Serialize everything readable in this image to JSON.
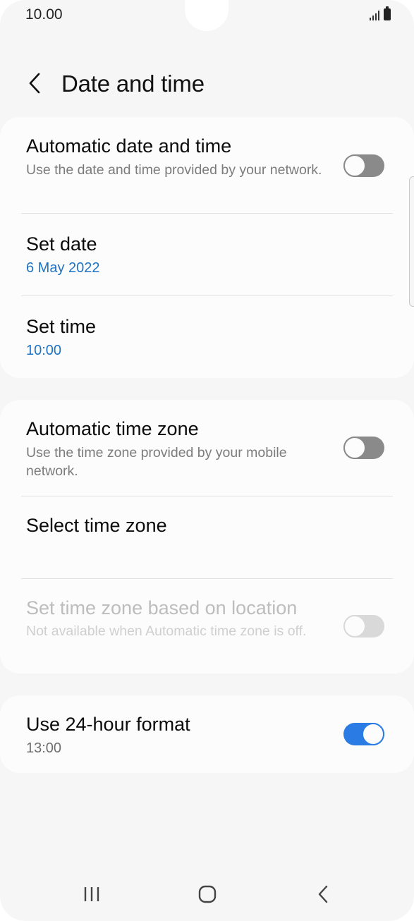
{
  "status_bar": {
    "time": "10.00",
    "signal_icon": "signal-bars-icon",
    "battery_icon": "battery-icon"
  },
  "header": {
    "back_icon": "chevron-left-icon",
    "title": "Date and time"
  },
  "section1": {
    "auto_date_time": {
      "title": "Automatic date and time",
      "subtitle": "Use the date and time provided by your network.",
      "enabled": false
    },
    "set_date": {
      "title": "Set date",
      "value": "6 May 2022"
    },
    "set_time": {
      "title": "Set time",
      "value": "10:00"
    }
  },
  "section2": {
    "auto_time_zone": {
      "title": "Automatic time zone",
      "subtitle": "Use the time zone provided by your mobile network.",
      "enabled": false
    },
    "select_time_zone": {
      "title": "Select time zone"
    },
    "time_zone_location": {
      "title": "Set time zone based on location",
      "subtitle": "Not available when Automatic time zone is off.",
      "enabled": false,
      "disabled": true
    }
  },
  "section3": {
    "use_24_hour": {
      "title": "Use 24-hour format",
      "value": "13:00",
      "enabled": true
    }
  },
  "nav_bar": {
    "recents_icon": "recent-apps-icon",
    "home_icon": "home-icon",
    "back_icon": "back-icon"
  },
  "colors": {
    "accent": "#2a7be4",
    "link_value": "#1f73c4",
    "background": "#f6f6f6",
    "card": "#fcfcfc"
  }
}
